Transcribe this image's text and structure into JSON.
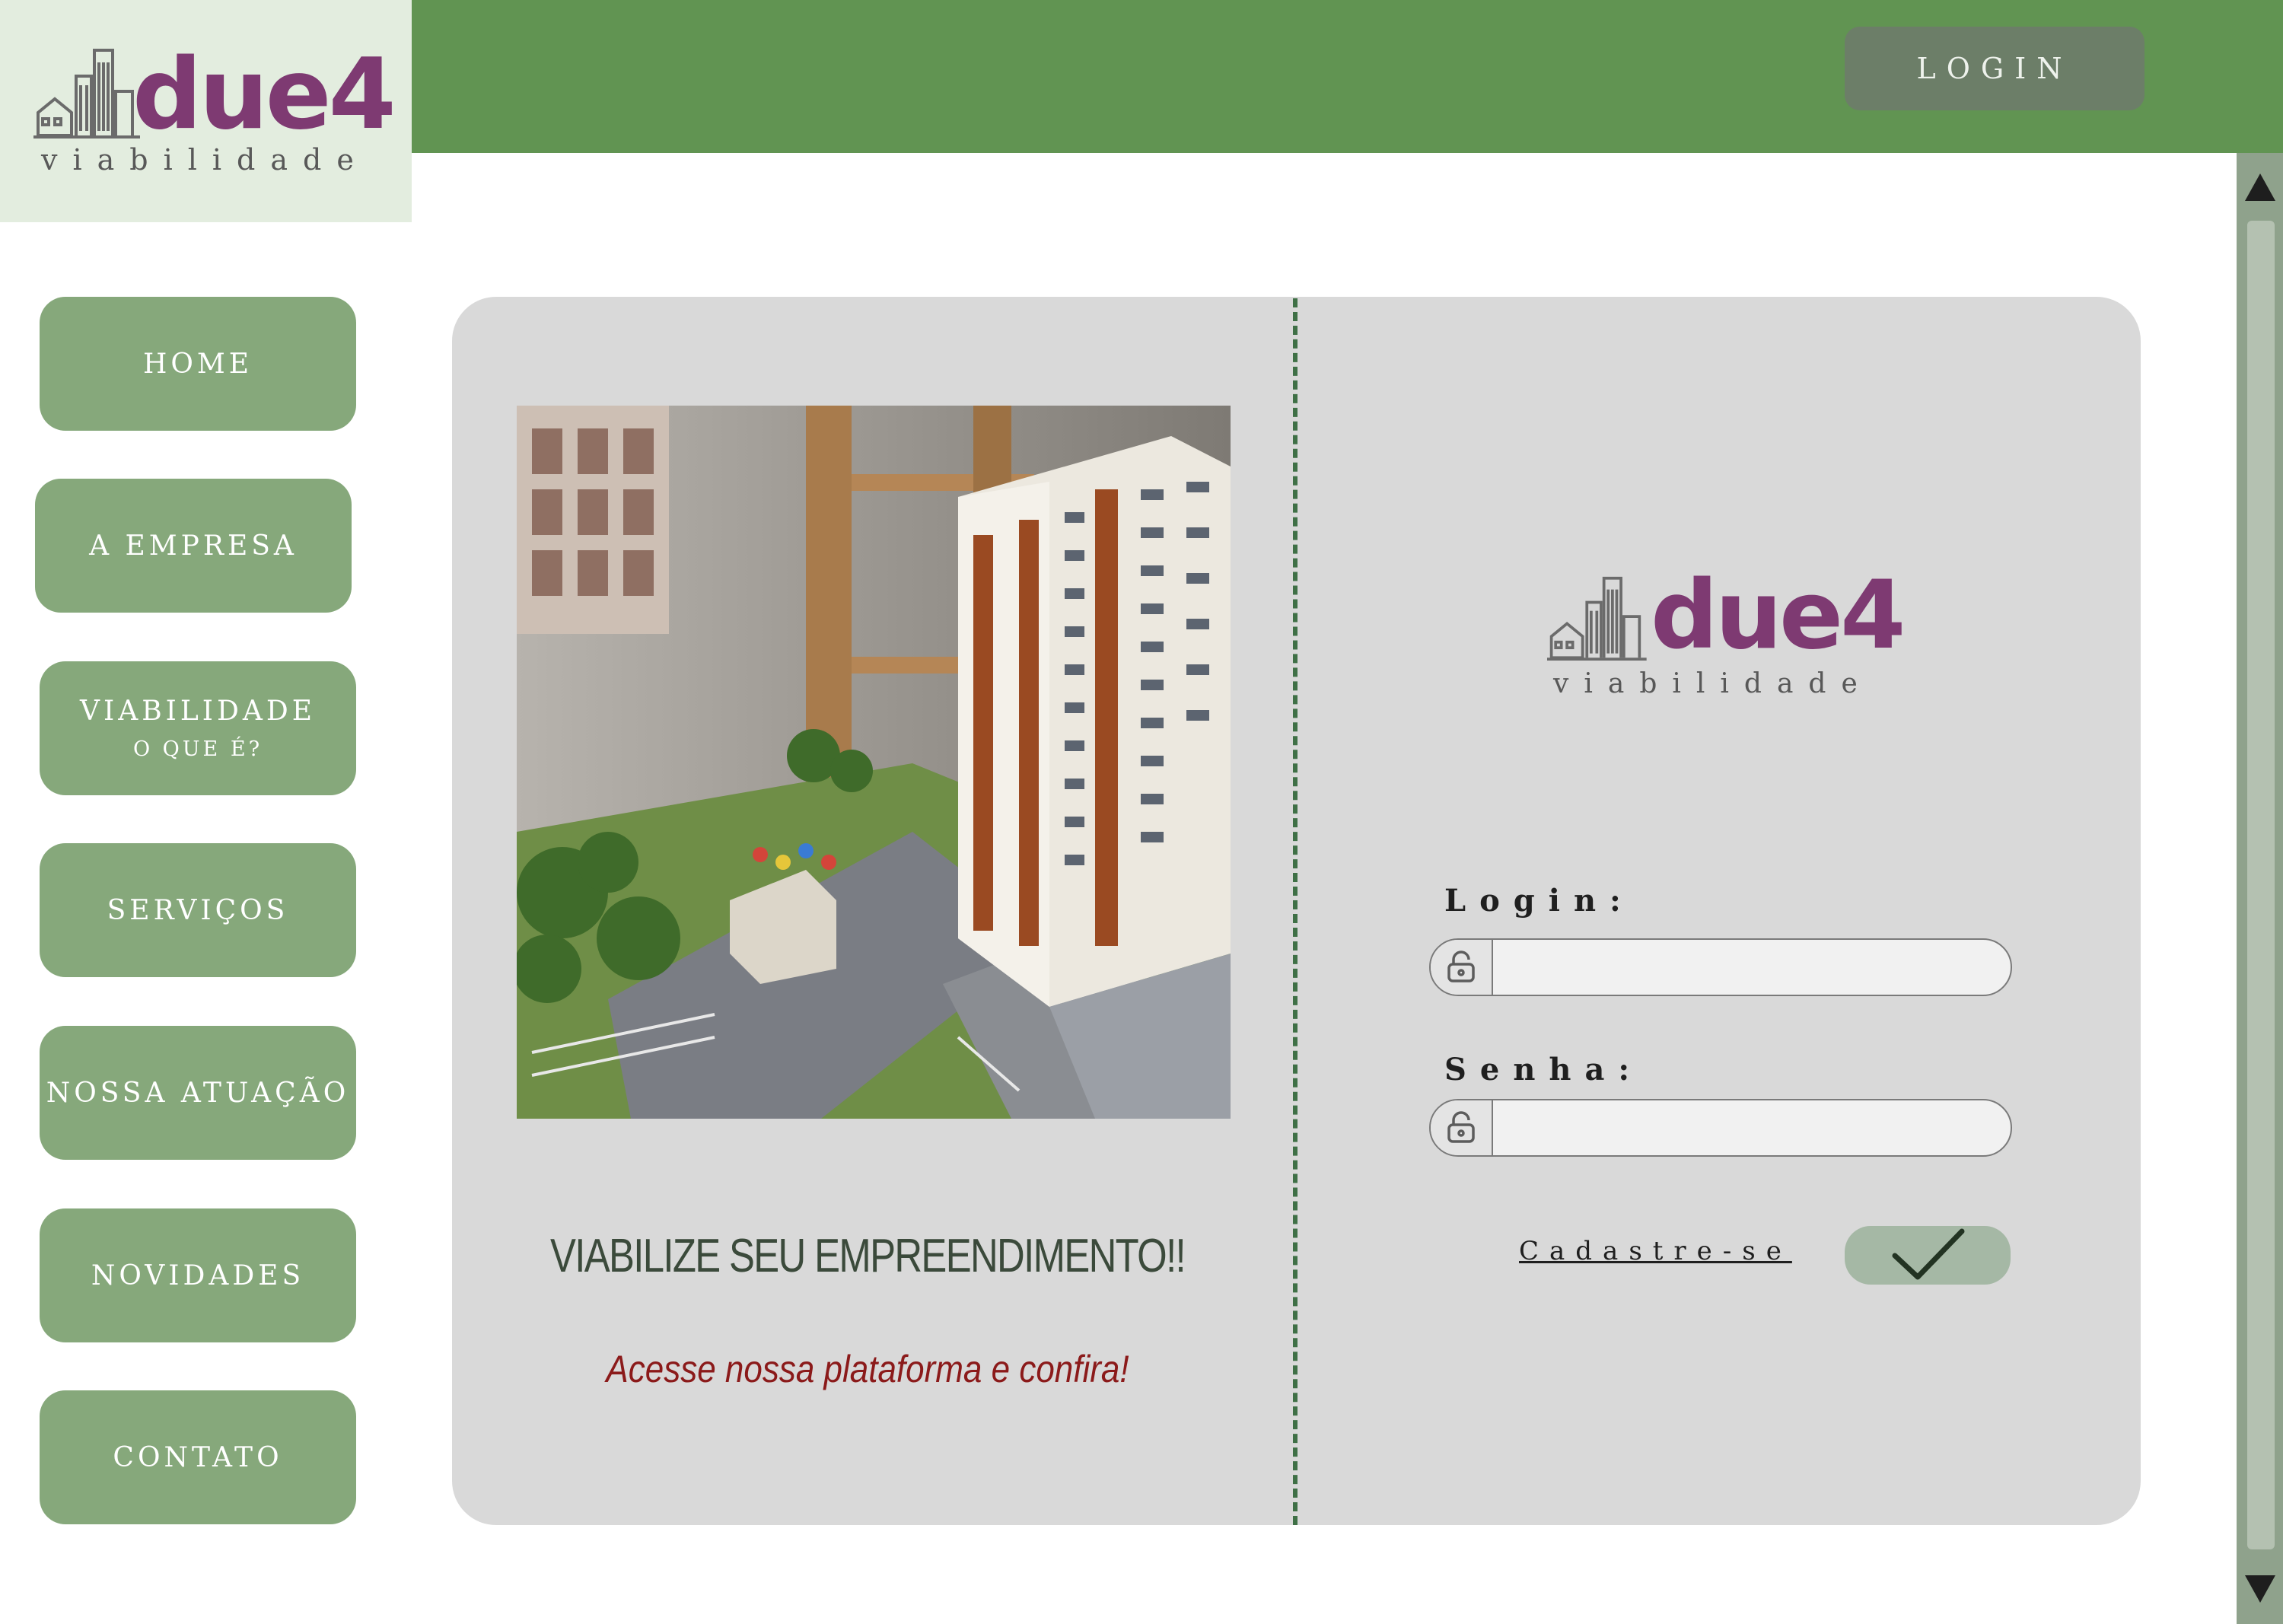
{
  "header": {
    "logo_brand": "due4",
    "logo_sub": "viabilidade",
    "login_label": "LOGIN",
    "bar_color": "#619452"
  },
  "sidebar": {
    "items": [
      {
        "label": "HOME",
        "sub": ""
      },
      {
        "label": "A EMPRESA",
        "sub": ""
      },
      {
        "label": "VIABILIDADE",
        "sub": "O QUE É?"
      },
      {
        "label": "SERVIÇOS",
        "sub": ""
      },
      {
        "label": "NOSSA ATUAÇÃO",
        "sub": ""
      },
      {
        "label": "NOVIDADES",
        "sub": ""
      },
      {
        "label": "CONTATO",
        "sub": ""
      }
    ],
    "button_color": "#86a87b"
  },
  "hero": {
    "image": "architectural-model-apartment-tower",
    "headline": "VIABILIZE SEU EMPREENDIMENTO!!",
    "tagline": "Acesse nossa plataforma e confira!"
  },
  "login_form": {
    "logo_brand": "due4",
    "logo_sub": "viabilidade",
    "login_label": "Login:",
    "login_value": "",
    "login_placeholder": "",
    "password_label": "Senha:",
    "password_value": "",
    "password_placeholder": "",
    "field_icon": "lock-icon",
    "signup_label": "Cadastre-se",
    "submit_icon": "checkmark-icon"
  },
  "colors": {
    "brand_purple": "#7e3a72",
    "card_gray": "#d9d9d9",
    "divider_green": "#3f7046",
    "tagline_red": "#8b1a1a"
  }
}
